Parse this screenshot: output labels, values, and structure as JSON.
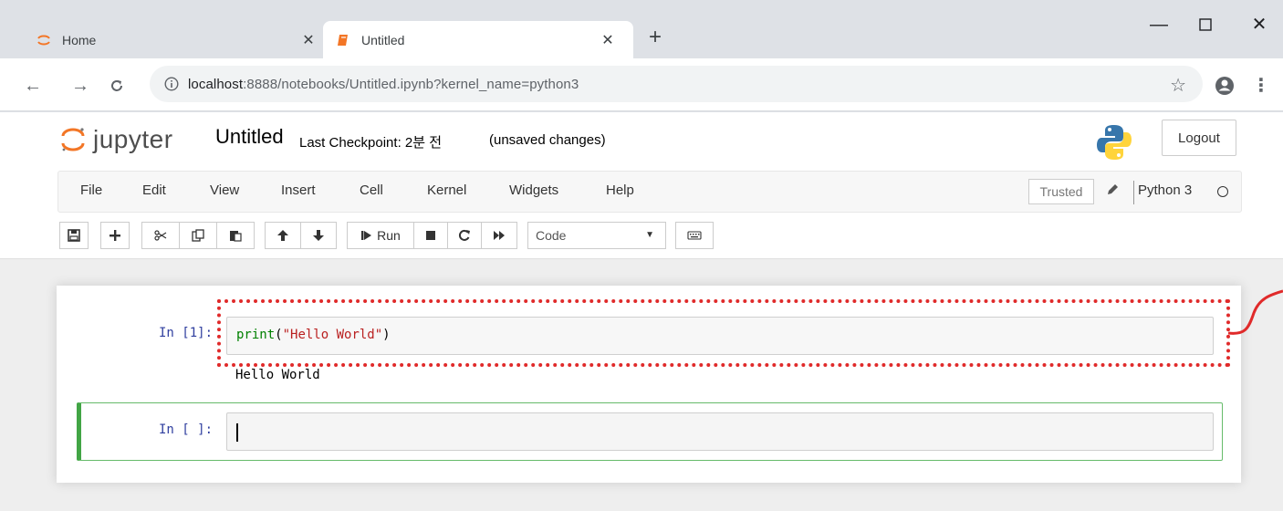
{
  "browser": {
    "tabs": [
      {
        "title": "Home",
        "active": false
      },
      {
        "title": "Untitled",
        "active": true
      }
    ],
    "url_host": "localhost",
    "url_rest": ":8888/notebooks/Untitled.ipynb?kernel_name=python3"
  },
  "jupyter": {
    "logo_text": "jupyter",
    "notebook_title": "Untitled",
    "checkpoint": "Last Checkpoint: 2분 전",
    "unsaved": "(unsaved changes)",
    "logout_label": "Logout",
    "menu": [
      "File",
      "Edit",
      "View",
      "Insert",
      "Cell",
      "Kernel",
      "Widgets",
      "Help"
    ],
    "trusted_label": "Trusted",
    "kernel_name": "Python 3",
    "run_label": "Run",
    "cell_type": "Code"
  },
  "cells": [
    {
      "prompt": "In [1]:",
      "code_fn": "print",
      "code_str": "\"Hello World\"",
      "output": "Hello World"
    },
    {
      "prompt": "In [ ]:"
    }
  ],
  "colors": {
    "accent_orange": "#f37626",
    "prompt_blue": "#303f9f",
    "highlight_red": "#e02a2a",
    "edit_green": "#42a545"
  }
}
